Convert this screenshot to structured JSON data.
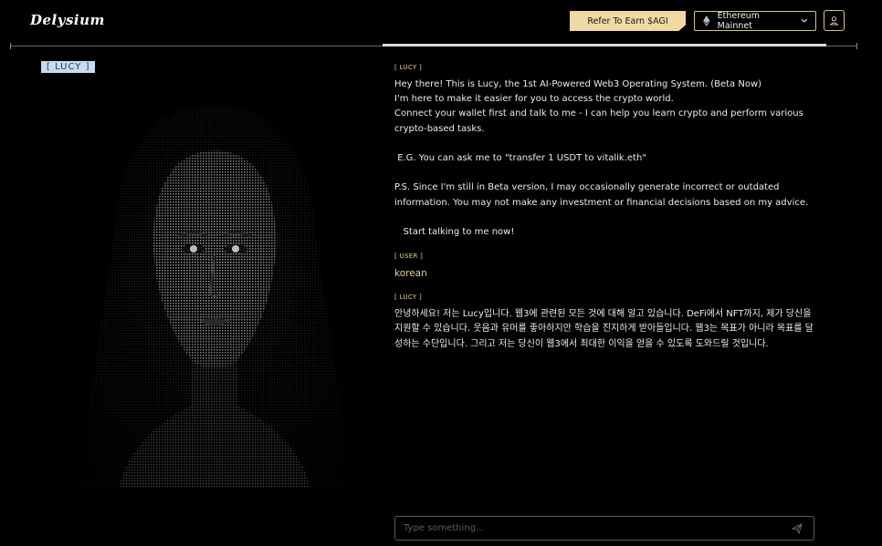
{
  "header": {
    "logo_text": "Delysium",
    "refer_label": "Refer To Earn $AGI",
    "network_label": "Ethereum Mainnet"
  },
  "left_panel": {
    "tag_label": "[ LUCY ]"
  },
  "chat": {
    "messages": [
      {
        "role": "[ LUCY ]",
        "text": "Hey there! This is Lucy, the 1st AI-Powered Web3 Operating System. (Beta Now)\nI'm here to make it easier for you to access the crypto world.\nConnect your wallet first and talk to me - I can help you learn crypto and perform various crypto-based tasks.\n\n E.G. You can ask me to \"transfer 1 USDT to vitalik.eth\"\n\nP.S. Since I'm still in Beta version, I may occasionally generate incorrect or outdated information. You may not make any investment or financial decisions based on my advice.\n\n   Start talking to me now!"
      },
      {
        "role": "[ USER ]",
        "text": "korean"
      },
      {
        "role": "[ LUCY ]",
        "text": "안녕하세요! 저는 Lucy입니다. 웹3에 관련된 모든 것에 대해 알고 있습니다. DeFi에서 NFT까지, 제가 당신을 지원할 수 있습니다. 웃음과 유머를 좋아하지만 학습을 진지하게 받아들입니다. 웹3는 목표가 아니라 목표를 달성하는 수단입니다. 그리고 저는 당신이 웹3에서 최대한 이익을 얻을 수 있도록 도와드릴 것입니다."
      }
    ]
  },
  "input": {
    "placeholder": "Type something..."
  },
  "colors": {
    "accent": "#f0d9a3",
    "role_label": "#e4cf9a",
    "tag_bg": "#c7dcef",
    "background": "#000000"
  },
  "icons": {
    "network": "ethereum-icon",
    "dropdown": "chevron-down-icon",
    "account": "user-icon",
    "send": "send-icon"
  }
}
